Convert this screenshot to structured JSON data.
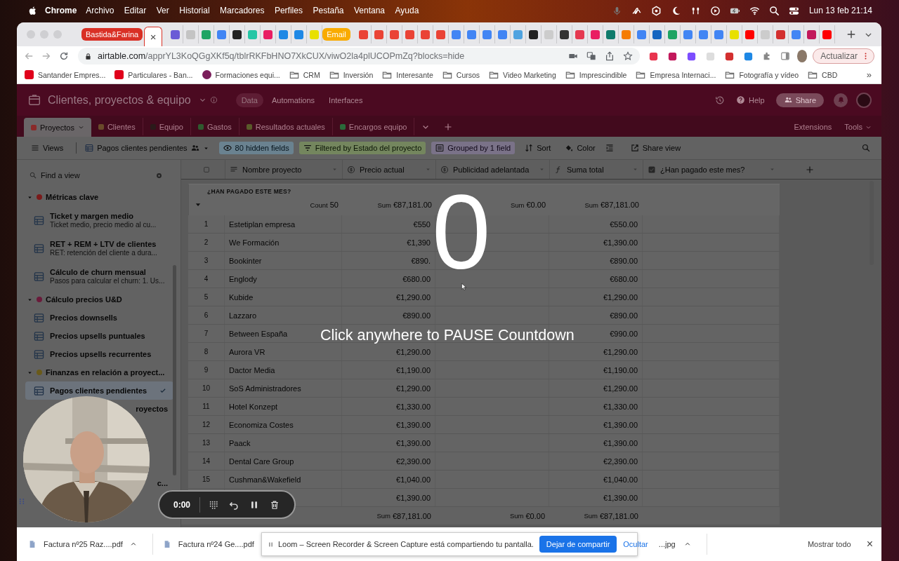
{
  "menubar": {
    "app": "Chrome",
    "menus": [
      "Archivo",
      "Editar",
      "Ver",
      "Historial",
      "Marcadores",
      "Perfiles",
      "Pestaña",
      "Ventana",
      "Ayuda"
    ],
    "clock": "Lun 13 feb 21:14"
  },
  "browser": {
    "tabs": [
      {
        "kind": "group",
        "label": "Bastida&Farina",
        "color": "#d93025"
      },
      {
        "kind": "page",
        "selected": true,
        "close": "×"
      },
      {
        "kind": "page",
        "selected": false,
        "color": "#6b5bd6"
      },
      {
        "kind": "page",
        "selected": false,
        "color": "#c4c4c4"
      },
      {
        "kind": "page",
        "selected": false,
        "color": "#1fa463"
      },
      {
        "kind": "page",
        "selected": false,
        "color": "#4285f4"
      },
      {
        "kind": "page",
        "selected": false,
        "color": "#222222"
      },
      {
        "kind": "page",
        "selected": false,
        "color": "#26c6a6"
      },
      {
        "kind": "page",
        "selected": false,
        "color": "#e91e63"
      },
      {
        "kind": "page",
        "selected": false,
        "color": "#1e88e5"
      },
      {
        "kind": "page",
        "selected": false,
        "color": "#1e88e5"
      },
      {
        "kind": "page",
        "selected": false,
        "color": "#e8e000"
      },
      {
        "kind": "group",
        "label": "Email",
        "color": "#f9ab00"
      },
      {
        "kind": "page",
        "selected": false,
        "color": "#ea4335"
      },
      {
        "kind": "page",
        "selected": false,
        "color": "#ea4335"
      },
      {
        "kind": "page",
        "selected": false,
        "color": "#ea4335"
      },
      {
        "kind": "page",
        "selected": false,
        "color": "#ea4335"
      },
      {
        "kind": "page",
        "selected": false,
        "color": "#ea4335"
      },
      {
        "kind": "page",
        "selected": false,
        "color": "#ea4335"
      },
      {
        "kind": "page",
        "selected": false,
        "color": "#4285f4"
      },
      {
        "kind": "page",
        "selected": false,
        "color": "#4285f4"
      },
      {
        "kind": "page",
        "selected": false,
        "color": "#4285f4"
      },
      {
        "kind": "page",
        "selected": false,
        "color": "#4285f4"
      },
      {
        "kind": "page",
        "selected": false,
        "color": "#4fa3e0"
      },
      {
        "kind": "page",
        "selected": false,
        "color": "#222222"
      },
      {
        "kind": "page",
        "selected": false,
        "color": "#cccccc"
      },
      {
        "kind": "page",
        "selected": false,
        "color": "#333333"
      },
      {
        "kind": "page",
        "selected": false,
        "color": "#e53950"
      },
      {
        "kind": "page",
        "selected": false,
        "color": "#e91e63"
      },
      {
        "kind": "page",
        "selected": false,
        "color": "#0f7b6c"
      },
      {
        "kind": "page",
        "selected": false,
        "color": "#f57c00"
      },
      {
        "kind": "page",
        "selected": false,
        "color": "#4285f4"
      },
      {
        "kind": "page",
        "selected": false,
        "color": "#1565c0"
      },
      {
        "kind": "page",
        "selected": false,
        "color": "#1fa463"
      },
      {
        "kind": "page",
        "selected": false,
        "color": "#4285f4"
      },
      {
        "kind": "page",
        "selected": false,
        "color": "#4285f4"
      },
      {
        "kind": "page",
        "selected": false,
        "color": "#4285f4"
      },
      {
        "kind": "page",
        "selected": false,
        "color": "#e8e000"
      },
      {
        "kind": "page",
        "selected": false,
        "color": "#ff0000"
      },
      {
        "kind": "page",
        "selected": false,
        "color": "#cccccc"
      },
      {
        "kind": "page",
        "selected": false,
        "color": "#d32f2f"
      },
      {
        "kind": "page",
        "selected": false,
        "color": "#4285f4"
      },
      {
        "kind": "page",
        "selected": false,
        "color": "#c2185b"
      },
      {
        "kind": "page",
        "selected": false,
        "color": "#ff0000"
      }
    ],
    "url": {
      "host": "airtable.com",
      "path": "/apprYL3KoQGgXKf5q/tblrRKFbHNO7XkCUX/viwO2la4plUCOPmZq?blocks=hide"
    },
    "update_button": "Actualizar",
    "bookmarks": [
      {
        "kind": "site",
        "label": "Santander Empres...",
        "color": "#e0001b"
      },
      {
        "kind": "site",
        "label": "Particulares - Ban...",
        "color": "#e0001b"
      },
      {
        "kind": "site",
        "label": "Formaciones equi...",
        "color": "#7a1e5a"
      },
      {
        "kind": "folder",
        "label": "CRM"
      },
      {
        "kind": "folder",
        "label": "Inversión"
      },
      {
        "kind": "folder",
        "label": "Interesante"
      },
      {
        "kind": "folder",
        "label": "Cursos"
      },
      {
        "kind": "folder",
        "label": "Video Marketing"
      },
      {
        "kind": "folder",
        "label": "Imprescindible"
      },
      {
        "kind": "folder",
        "label": "Empresa Internaci..."
      },
      {
        "kind": "folder",
        "label": "Fotografía y vídeo"
      },
      {
        "kind": "folder",
        "label": "CBD"
      }
    ],
    "bookmarks_more": "»"
  },
  "app": {
    "base_title": "Clientes, proyectos & equipo",
    "nav": [
      {
        "label": "Data",
        "selected": true
      },
      {
        "label": "Automations",
        "selected": false
      },
      {
        "label": "Interfaces",
        "selected": false
      }
    ],
    "help": "Help",
    "share": "Share",
    "tables": [
      {
        "label": "Proyectos",
        "selected": true,
        "color": "#8a2a2a"
      },
      {
        "label": "Clientes",
        "selected": false,
        "color": "#6a4a2a"
      },
      {
        "label": "Equipo",
        "selected": false,
        "color": "#2a1a1a"
      },
      {
        "label": "Gastos",
        "selected": false,
        "color": "#2f5a2f"
      },
      {
        "label": "Resultados actuales",
        "selected": false,
        "color": "#5a5a2a"
      },
      {
        "label": "Encargos equipo",
        "selected": false,
        "color": "#2a6a3a"
      }
    ],
    "extensions": "Extensions",
    "tools": "Tools",
    "toolbar": {
      "views": "Views",
      "view_name": "Pagos clientes pendientes",
      "items": [
        {
          "kind": "hidden",
          "label": "80 hidden fields"
        },
        {
          "kind": "filter",
          "label": "Filtered by Estado del proyecto"
        },
        {
          "kind": "group",
          "label": "Grouped by 1 field"
        },
        {
          "kind": "sort",
          "label": "Sort"
        },
        {
          "kind": "color",
          "label": "Color"
        },
        {
          "kind": "height"
        },
        {
          "kind": "share",
          "label": "Share view"
        }
      ]
    },
    "sidebar": {
      "search_placeholder": "Find a view",
      "sections": [
        {
          "label": "Métricas clave",
          "color": "#7a1a1a",
          "items": [
            {
              "kind": "view",
              "label": "Ticket y margen medio",
              "subtitle": "Ticket medio, precio medio al cu...",
              "selected": false
            },
            {
              "kind": "view",
              "label": "RET + REM + LTV de clientes",
              "subtitle": "RET: retención del cliente a dura...",
              "selected": false
            },
            {
              "kind": "view",
              "label": "Cálculo de churn mensual",
              "subtitle": "Pasos para calcular el churn: 1. Us...",
              "selected": false
            }
          ]
        },
        {
          "label": "Cálculo precios U&D",
          "color": "#6a1a3a",
          "items": [
            {
              "kind": "view",
              "label": "Precios downsells",
              "selected": false
            },
            {
              "kind": "view",
              "label": "Precios upsells puntuales",
              "selected": false
            },
            {
              "kind": "view",
              "label": "Precios upsells recurrentes",
              "selected": false
            }
          ]
        },
        {
          "label": "Finanzas en relación a proyect...",
          "color": "#6a5a1a",
          "items": [
            {
              "kind": "view",
              "label": "Pagos clientes pendientes",
              "selected": true
            },
            {
              "kind": "cut",
              "label": "royectos",
              "selected": false
            },
            {
              "kind": "cut",
              "label": "c...",
              "selected": false
            }
          ]
        }
      ]
    },
    "grid": {
      "columns": [
        {
          "kind": "text",
          "label": "Nombre proyecto"
        },
        {
          "kind": "currency",
          "label": "Precio actual"
        },
        {
          "kind": "currency",
          "label": "Publicidad adelantada"
        },
        {
          "kind": "formula",
          "label": "Suma total"
        },
        {
          "kind": "checkbox",
          "label": "¿Han pagado este mes?"
        }
      ],
      "group": {
        "label": "¿HAN PAGADO ESTE MES?",
        "count_label": "Count",
        "count": "50",
        "sums": [
          {
            "label": "Sum",
            "value": "€87,181.00"
          },
          {
            "label": "Sum",
            "value": "€0.00"
          },
          {
            "label": "Sum",
            "value": "€87,181.00"
          }
        ]
      },
      "rows": [
        {
          "number": "1",
          "name": "Estetiplan empresa",
          "price": "€550",
          "total": "€550.00"
        },
        {
          "number": "2",
          "name": "We Formación",
          "price": "€1,390",
          "total": "€1,390.00"
        },
        {
          "number": "3",
          "name": "Bookinter",
          "price": "€890.",
          "total": "€890.00"
        },
        {
          "number": "4",
          "name": "Englody",
          "price": "€680.00",
          "total": "€680.00"
        },
        {
          "number": "5",
          "name": "Kubide",
          "price": "€1,290.00",
          "total": "€1,290.00"
        },
        {
          "number": "6",
          "name": "Lazzaro",
          "price": "€890.00",
          "total": "€890.00"
        },
        {
          "number": "7",
          "name": "Between España",
          "total": "€990.00"
        },
        {
          "number": "8",
          "name": "Aurora VR",
          "price": "€1,290.00",
          "total": "€1,290.00"
        },
        {
          "number": "9",
          "name": "Dactor Media",
          "price": "€1,190.00",
          "total": "€1,190.00"
        },
        {
          "number": "10",
          "name": "SoS Administradores",
          "price": "€1,290.00",
          "total": "€1,290.00"
        },
        {
          "number": "11",
          "name": "Hotel Konzept",
          "price": "€1,330.00",
          "total": "€1,330.00"
        },
        {
          "number": "12",
          "name": "Economiza Costes",
          "price": "€1,390.00",
          "total": "€1,390.00"
        },
        {
          "number": "13",
          "name": "Paack",
          "price": "€1,390.00",
          "total": "€1,390.00"
        },
        {
          "number": "14",
          "name": "Dental Care Group",
          "price": "€2,390.00",
          "total": "€2,390.00"
        },
        {
          "number": "15",
          "name": "Cushman&Wakefield",
          "price": "€1,040.00",
          "total": "€1,040.00"
        },
        {
          "price": "€1,390.00",
          "total": "€1,390.00"
        }
      ],
      "footer": [
        {
          "label": "Sum",
          "value": "€87,181.00"
        },
        {
          "label": "Sum",
          "value": "€0.00"
        },
        {
          "label": "Sum",
          "value": "€87,181.00"
        }
      ]
    }
  },
  "countdown": {
    "digit": "0",
    "message": "Click anywhere to PAUSE Countdown"
  },
  "recorder": {
    "time": "0:00"
  },
  "downloads": {
    "items": [
      {
        "kind": "file",
        "name": "Factura nº25 Raz....pdf"
      },
      {
        "kind": "covered",
        "name": "Factura nº24 Ge....pdf"
      },
      {
        "kind": "cut",
        "name": "...jpg"
      }
    ],
    "show_all": "Mostrar todo",
    "close": "×",
    "banner": {
      "message": "Loom – Screen Recorder & Screen Capture está compartiendo tu pantalla.",
      "stop": "Dejar de compartir",
      "hide": "Ocultar"
    }
  }
}
